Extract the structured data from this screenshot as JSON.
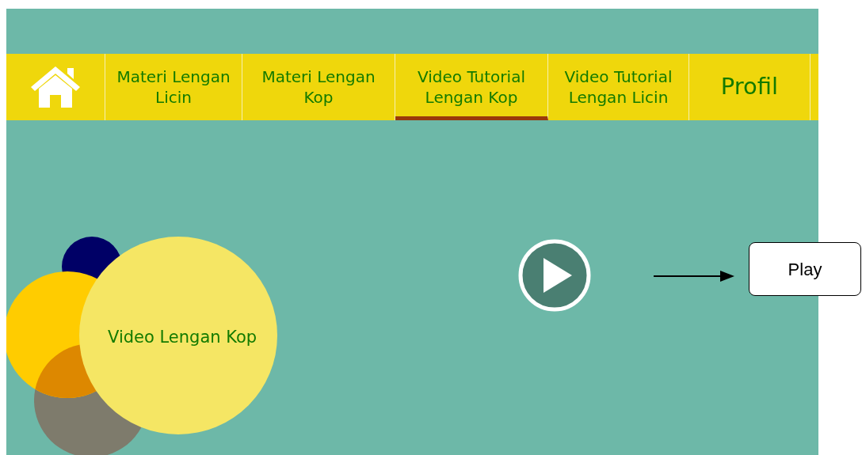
{
  "nav": {
    "tabs": [
      {
        "kind": "home",
        "selected": false
      },
      {
        "kind": "text",
        "label": "Materi Lengan Licin",
        "selected": false
      },
      {
        "kind": "text",
        "label": "Materi Lengan Kop",
        "selected": false
      },
      {
        "kind": "text",
        "label": "Video Tutorial Lengan Kop",
        "selected": true
      },
      {
        "kind": "text",
        "label": "Video Tutorial Lengan Licin",
        "selected": false
      },
      {
        "kind": "large",
        "label": "Profil",
        "selected": false
      }
    ]
  },
  "video": {
    "title": "Video Lengan Kop"
  },
  "annotation": {
    "label": "Play"
  }
}
